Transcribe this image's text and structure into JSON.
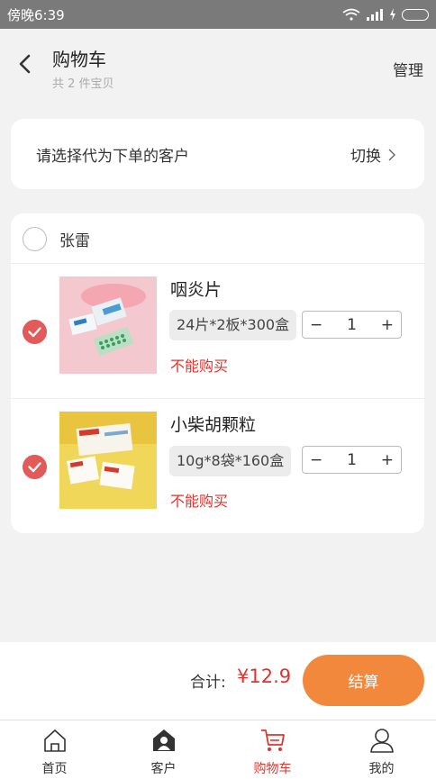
{
  "status_bar": {
    "time": "傍晚6:39"
  },
  "header": {
    "title": "购物车",
    "subtitle": "共 2 件宝贝",
    "manage_label": "管理"
  },
  "customer_select": {
    "prompt": "请选择代为下单的客户",
    "switch_label": "切换"
  },
  "cart": {
    "customer_name": "张雷",
    "items": [
      {
        "name": "咽炎片",
        "spec": "24片*2板*300盒",
        "quantity": "1",
        "warning": "不能购买",
        "checked": true
      },
      {
        "name": "小柴胡颗粒",
        "spec": "10g*8袋*160盒",
        "quantity": "1",
        "warning": "不能购买",
        "checked": true
      }
    ]
  },
  "footer": {
    "total_label": "合计:",
    "total_value": "¥12.9",
    "checkout_label": "结算"
  },
  "tabbar": {
    "items": [
      {
        "label": "首页",
        "icon": "home-icon"
      },
      {
        "label": "客户",
        "icon": "customer-icon"
      },
      {
        "label": "购物车",
        "icon": "cart-icon",
        "active": true
      },
      {
        "label": "我的",
        "icon": "user-icon"
      }
    ]
  },
  "colors": {
    "accent": "#f1883c",
    "price": "#e0332e",
    "check": "#e35a5a"
  }
}
